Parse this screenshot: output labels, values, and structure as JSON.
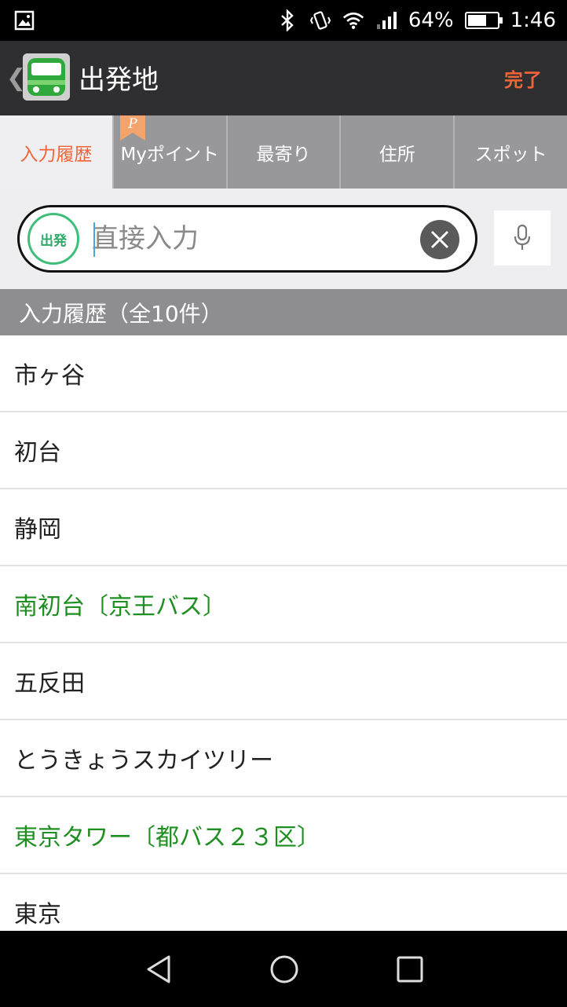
{
  "status_bar": {
    "battery_percent": "64%",
    "battery_level": 0.64,
    "time": "1:46",
    "icons": [
      "gallery-icon",
      "bluetooth-icon",
      "vibrate-icon",
      "wifi-icon",
      "signal-icon",
      "battery-icon"
    ]
  },
  "header": {
    "title": "出発地",
    "done_label": "完了",
    "back_icon": "back-chevron-icon",
    "app_icon": "train-icon"
  },
  "tabs": [
    {
      "label": "入力履歴",
      "active": true
    },
    {
      "label": "Myポイント",
      "active": false,
      "badge_icon": "bookmark-p-icon",
      "badge_text": "P"
    },
    {
      "label": "最寄り",
      "active": false
    },
    {
      "label": "住所",
      "active": false
    },
    {
      "label": "スポット",
      "active": false
    }
  ],
  "search": {
    "badge": "出発",
    "placeholder": "直接入力",
    "value": ""
  },
  "section": {
    "title": "入力履歴（全10件）"
  },
  "history": [
    {
      "label": "市ヶ谷",
      "type": "station"
    },
    {
      "label": "初台",
      "type": "station"
    },
    {
      "label": "静岡",
      "type": "station"
    },
    {
      "label": "南初台〔京王バス〕",
      "type": "bus"
    },
    {
      "label": "五反田",
      "type": "station"
    },
    {
      "label": "とうきょうスカイツリー",
      "type": "station"
    },
    {
      "label": "東京タワー〔都バス２３区〕",
      "type": "bus"
    },
    {
      "label": "東京",
      "type": "station"
    }
  ],
  "colors": {
    "accent": "#f0643a",
    "bus_green": "#1f8f21",
    "depart_green": "#3dbf7a",
    "header_bg": "#2f2f31",
    "tab_bg": "#98989b"
  }
}
